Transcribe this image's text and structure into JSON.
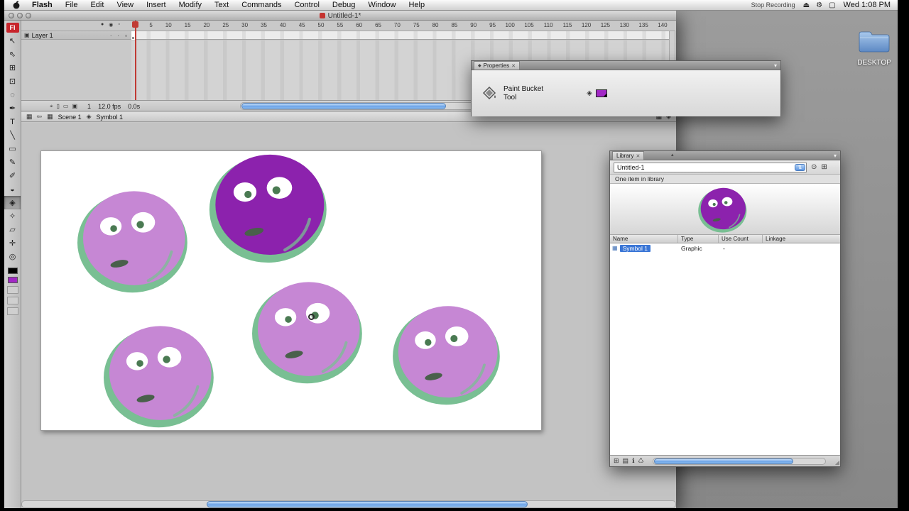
{
  "colors": {
    "blob-light": "#c687d4",
    "blob-dark": "#8c22ad",
    "blob-green": "#79bf93",
    "blob-pupil": "#4a7a52",
    "blob-mouth": "#49604b",
    "swatch-purple": "#a228c6",
    "selection-blue": "#3a76d6"
  },
  "menubar": {
    "items": [
      "Flash",
      "File",
      "Edit",
      "View",
      "Insert",
      "Modify",
      "Text",
      "Commands",
      "Control",
      "Debug",
      "Window",
      "Help"
    ],
    "stop_recording": "Stop Recording",
    "extras": [
      {
        "name": "eject-icon",
        "glyph": "⏏"
      },
      {
        "name": "settings-icon",
        "glyph": "⚙"
      },
      {
        "name": "display-icon",
        "glyph": "▢"
      }
    ],
    "clock": "Wed 1:08 PM"
  },
  "window": {
    "title": "Untitled-1*",
    "app_badge": "Fl"
  },
  "tools": [
    {
      "name": "tool-selection",
      "glyph": "↖",
      "selected": "false"
    },
    {
      "name": "tool-subselection",
      "glyph": "⇖",
      "selected": "false"
    },
    {
      "name": "tool-free-transform",
      "glyph": "⊞",
      "selected": "false"
    },
    {
      "name": "tool-gradient-transform",
      "glyph": "⊡",
      "selected": "false"
    },
    {
      "name": "tool-lasso",
      "glyph": "◌",
      "selected": "false"
    },
    {
      "name": "tool-pen",
      "glyph": "✒",
      "selected": "false"
    },
    {
      "name": "tool-text",
      "glyph": "T",
      "selected": "false"
    },
    {
      "name": "tool-line",
      "glyph": "╲",
      "selected": "false"
    },
    {
      "name": "tool-rectangle",
      "glyph": "▭",
      "selected": "false"
    },
    {
      "name": "tool-pencil",
      "glyph": "✎",
      "selected": "false"
    },
    {
      "name": "tool-brush",
      "glyph": "✐",
      "selected": "false"
    },
    {
      "name": "tool-ink-bottle",
      "glyph": "◒",
      "selected": "false"
    },
    {
      "name": "tool-paint-bucket",
      "glyph": "◈",
      "selected": "true"
    },
    {
      "name": "tool-eyedropper",
      "glyph": "✧",
      "selected": "false"
    },
    {
      "name": "tool-eraser",
      "glyph": "▱",
      "selected": "false"
    },
    {
      "name": "tool-hand",
      "glyph": "✛",
      "selected": "false"
    },
    {
      "name": "tool-zoom",
      "glyph": "◎",
      "selected": "false"
    }
  ],
  "timeline": {
    "layer_name": "Layer 1",
    "layer_icon": "▣",
    "column_icons": [
      {
        "name": "show-hide-column-icon",
        "glyph": "●"
      },
      {
        "name": "lock-column-icon",
        "glyph": "◉"
      },
      {
        "name": "outline-column-icon",
        "glyph": "▫"
      }
    ],
    "layer_dots": [
      {
        "name": "layer-visible-dot",
        "glyph": "·"
      },
      {
        "name": "layer-locked-dot",
        "glyph": "·"
      },
      {
        "name": "layer-outline-swatch",
        "glyph": "▫"
      }
    ],
    "ruler": [
      "5",
      "10",
      "15",
      "20",
      "25",
      "30",
      "35",
      "40",
      "45",
      "50",
      "55",
      "60",
      "65",
      "70",
      "75",
      "80",
      "85",
      "90",
      "95",
      "100",
      "105",
      "110",
      "115",
      "120",
      "125",
      "130",
      "135",
      "140"
    ],
    "status_icons": [
      {
        "name": "center-frame-icon",
        "glyph": "⌖"
      },
      {
        "name": "onion-skin-icon",
        "glyph": "▯"
      },
      {
        "name": "onion-skin-outlines-icon",
        "glyph": "▭"
      },
      {
        "name": "edit-multiple-frames-icon",
        "glyph": "▣"
      }
    ],
    "status": {
      "frame": "1",
      "fps": "12.0 fps",
      "time": "0.0s"
    }
  },
  "editbar": {
    "left_icons": [
      {
        "name": "show-timeline-icon",
        "glyph": "▦"
      },
      {
        "name": "back-arrow-icon",
        "glyph": "⇦"
      }
    ],
    "scene_icon": "▦",
    "scene": "Scene 1",
    "symbol_icon": "◈",
    "symbol": "Symbol 1",
    "right_icons": [
      {
        "name": "edit-scene-button",
        "glyph": "▦"
      },
      {
        "name": "edit-symbol-button",
        "glyph": "◈"
      }
    ]
  },
  "properties": {
    "tab_icon": "◆",
    "tab": "Properties",
    "close_icon": "✕",
    "menu_icon": "▾",
    "tool_name": "Paint Bucket",
    "tool_line2": "Tool",
    "fill_icon": "◈"
  },
  "library": {
    "tab": "Library",
    "close_icon": "✕",
    "menu_icon": "▾",
    "document": "Untitled-1",
    "dropdown_icon": "⇅",
    "toolbar_icons": [
      {
        "name": "pin-icon",
        "glyph": "⊙"
      },
      {
        "name": "new-library-panel-icon",
        "glyph": "⊞"
      }
    ],
    "count_text": "One item in library",
    "columns": [
      "Name",
      "Type",
      "Use Count",
      "Linkage"
    ],
    "sort_icon": "▴",
    "rows": [
      {
        "name": "Symbol 1",
        "type": "Graphic",
        "use_count": "-",
        "linkage": ""
      }
    ],
    "bottom_icons": [
      {
        "name": "new-symbol-icon",
        "glyph": "⊞"
      },
      {
        "name": "new-folder-icon",
        "glyph": "▤"
      },
      {
        "name": "properties-icon",
        "glyph": "ℹ"
      },
      {
        "name": "delete-icon",
        "glyph": "♺"
      }
    ],
    "resize_grip": "◢"
  },
  "desktop": {
    "folder_label": "DESKTOP"
  }
}
